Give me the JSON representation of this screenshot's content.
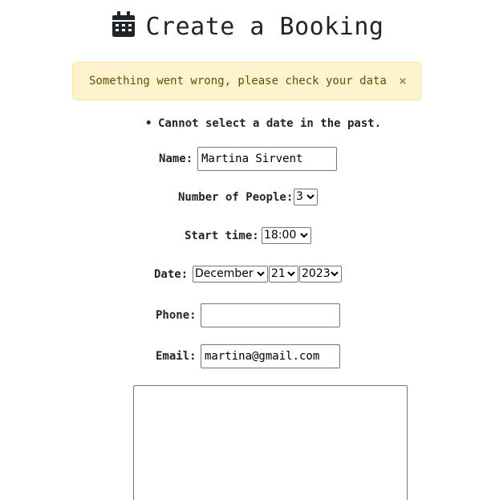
{
  "page": {
    "title": "Create a Booking",
    "title_icon": "calendar-icon"
  },
  "alert": {
    "message": "Something went wrong, please check your data",
    "close_symbol": "×"
  },
  "errors": [
    "Cannot select a date in the past."
  ],
  "form": {
    "name": {
      "label": "Name:",
      "value": "Martina Sirvent"
    },
    "people": {
      "label": "Number of People:",
      "value": "3"
    },
    "start_time": {
      "label": "Start time:",
      "value": "18:00"
    },
    "date": {
      "label": "Date:",
      "month": "December",
      "day": "21",
      "year": "2023"
    },
    "phone": {
      "label": "Phone:",
      "value": ""
    },
    "email": {
      "label": "Email:",
      "value": "martina@gmail.com"
    },
    "message": {
      "value": ""
    }
  },
  "colors": {
    "alert_bg": "#fff3cd",
    "alert_border": "#ffe69c",
    "alert_text": "#664d03"
  }
}
